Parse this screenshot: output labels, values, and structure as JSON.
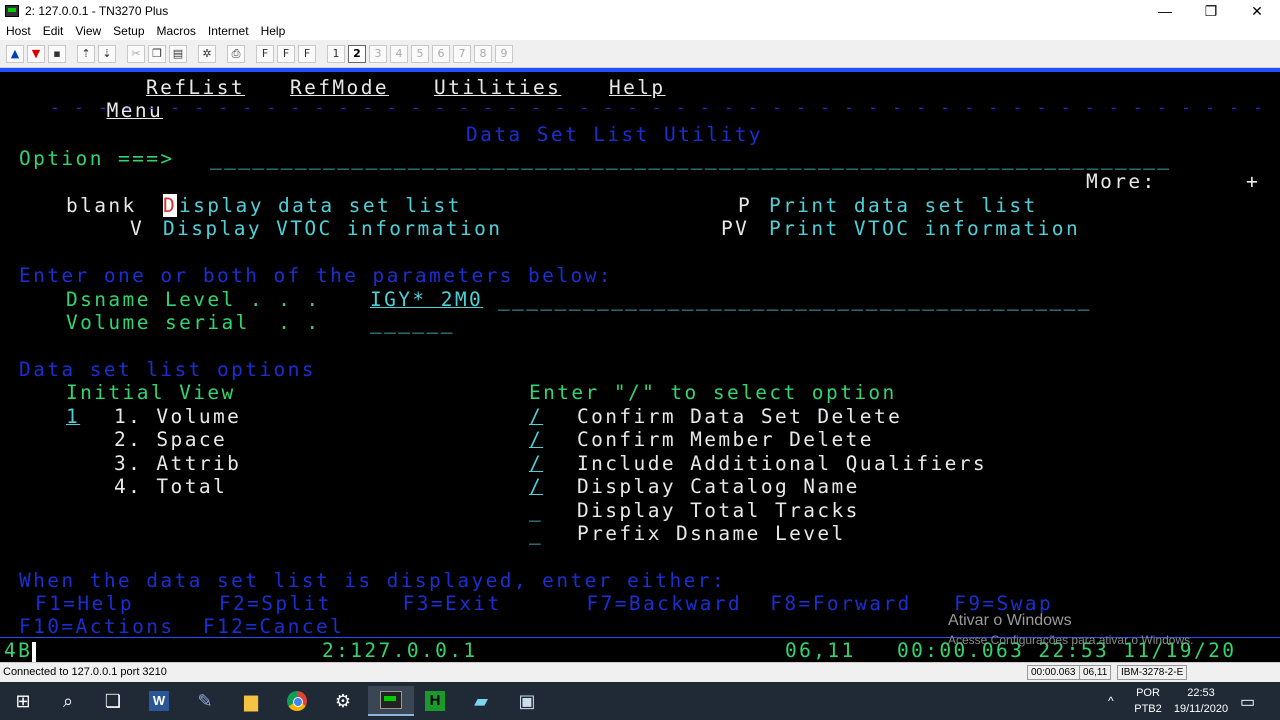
{
  "window": {
    "title": "2: 127.0.0.1 - TN3270 Plus",
    "minimize": "—",
    "restore": "❐",
    "close": "✕"
  },
  "menu": [
    "Host",
    "Edit",
    "View",
    "Setup",
    "Macros",
    "Internet",
    "Help"
  ],
  "toolbar": {
    "font_buttons": [
      "F",
      "F",
      "F"
    ],
    "sessions": [
      "1",
      "2",
      "3",
      "4",
      "5",
      "6",
      "7",
      "8",
      "9"
    ],
    "active_session": "2"
  },
  "screen": {
    "action_bar": [
      "Menu",
      "RefList",
      "RefMode",
      "Utilities",
      "Help"
    ],
    "separator": "- - - - - - - - - - - - - - - - - - - - - - - - - - - - - - - - - - - - - - - - - - - - - - - - - - - - - - - - - - - - - - - - - - - - - - - - - - - - - - - - - - - -",
    "panel_title": "Data Set List Utility",
    "option_label": "Option ===>",
    "option_field": "____________________________________________________________________",
    "more_label": "More:",
    "more_indicator": "+",
    "opt_blank_code": "blank",
    "opt_blank_cursor_char": "D",
    "opt_blank_desc": "isplay data set list",
    "opt_p_code": "P",
    "opt_p_desc": "Print data set list",
    "opt_v_code": "V",
    "opt_v_desc": "Display VTOC information",
    "opt_pv_code": "PV",
    "opt_pv_desc": "Print VTOC information",
    "params_heading": "Enter one or both of the parameters below:",
    "dsname_label": "Dsname Level . . .",
    "dsname_value": "IGY* 2M0",
    "dsname_fill": "__________________________________________",
    "volume_label": "Volume serial  . .",
    "volume_value": "______",
    "list_options_heading": "Data set list options",
    "initial_view_label": "Initial View",
    "initial_view_value": "1",
    "views": [
      "1. Volume",
      "2. Space",
      "3. Attrib",
      "4. Total"
    ],
    "select_heading": "Enter \"/\" to select option",
    "options": [
      {
        "mark": "/",
        "label": "Confirm Data Set Delete"
      },
      {
        "mark": "/",
        "label": "Confirm Member Delete"
      },
      {
        "mark": "/",
        "label": "Include Additional Qualifiers"
      },
      {
        "mark": "/",
        "label": "Display Catalog Name"
      },
      {
        "mark": "_",
        "label": "Display Total Tracks"
      },
      {
        "mark": "_",
        "label": "Prefix Dsname Level"
      }
    ],
    "when_text": "When the data set list is displayed, enter either:",
    "pf_line1": "F1=Help      F2=Split     F3=Exit      F7=Backward  F8=Forward   F9=Swap",
    "pf_line2": "F10=Actions  F12=Cancel"
  },
  "oia": {
    "status": "4B",
    "host": "2:127.0.0.1",
    "cursor": "06,11",
    "time_info": "00:00.063 22:53 11/19/20"
  },
  "watermark": {
    "line1": "Ativar o Windows",
    "line2": "Acesse Configurações para ativar o Windows."
  },
  "statusbar": {
    "connection": "Connected to 127.0.0.1 port 3210",
    "elapsed": "00:00.063",
    "cursor": "06,11",
    "model": "IBM-3278-2-E"
  },
  "taskbar": {
    "language": "POR",
    "layout": "PTB2",
    "time": "22:53",
    "date": "19/11/2020"
  }
}
